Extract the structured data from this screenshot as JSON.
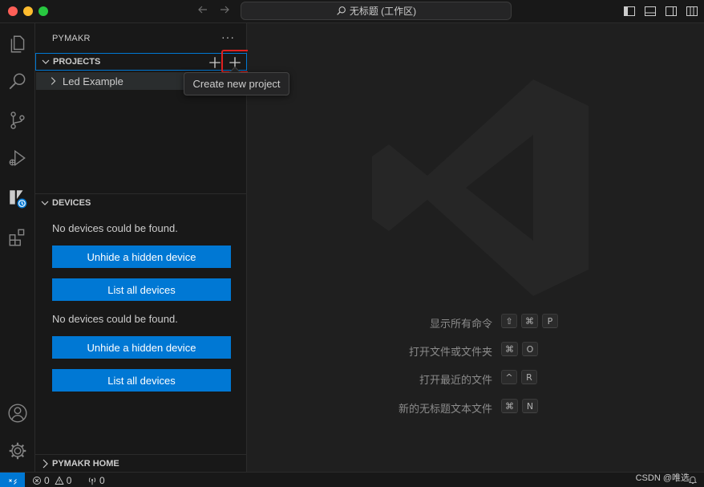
{
  "window": {
    "title": "无标题 (工作区)"
  },
  "sidebar": {
    "title": "PYMAKR",
    "more_label": "···",
    "projects": {
      "header": "PROJECTS",
      "items": [
        {
          "label": "Led Example"
        }
      ]
    },
    "devices": {
      "header": "DEVICES",
      "groups": [
        {
          "message": "No devices could be found.",
          "unhide_label": "Unhide a hidden device",
          "list_label": "List all devices"
        },
        {
          "message": "No devices could be found.",
          "unhide_label": "Unhide a hidden device",
          "list_label": "List all devices"
        }
      ]
    },
    "home": {
      "header": "PYMAKR HOME"
    }
  },
  "tooltip": {
    "text": "Create new project"
  },
  "editor": {
    "shortcuts": [
      {
        "label": "显示所有命令",
        "keys": [
          "⇧",
          "⌘",
          "P"
        ]
      },
      {
        "label": "打开文件或文件夹",
        "keys": [
          "⌘",
          "O"
        ]
      },
      {
        "label": "打开最近的文件",
        "keys": [
          "^",
          "R"
        ]
      },
      {
        "label": "新的无标题文本文件",
        "keys": [
          "⌘",
          "N"
        ]
      }
    ]
  },
  "statusbar": {
    "errors": "0",
    "warnings": "0",
    "ports": "0",
    "watermark": "CSDN @唯选"
  },
  "colors": {
    "accent": "#0078d4",
    "highlight": "#e02020",
    "background": "#1f1f1f",
    "sidebar": "#181818"
  }
}
